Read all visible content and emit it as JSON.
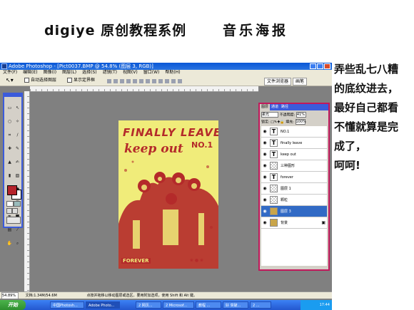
{
  "header": {
    "title": "digiye 原创教程系例",
    "subtitle": "音乐海报"
  },
  "window": {
    "title": "Adobe Photoshop - [Pict0037.BMP @ 54.8% (图层 3, RGB)]",
    "menu": [
      "文件(F)",
      "编辑(E)",
      "图像(I)",
      "图层(L)",
      "选择(S)",
      "滤镜(T)",
      "视图(V)",
      "窗口(W)",
      "帮助(H)"
    ],
    "options": {
      "auto_select": "自动选择图层",
      "show_bounds": "显示定界框",
      "tabs": [
        "文件浏览器",
        "画笔"
      ]
    },
    "statusbar": {
      "zoom": "54.89%",
      "doc": "文档:1.34M/54.6M",
      "hint": "点按并拖移以移动图层或选区。要用附加选项，使用 Shift 和 Alt 键。"
    }
  },
  "poster": {
    "line1": "FINALLY LEAVE",
    "line2": "NO.1",
    "line3": "keep out",
    "footer": "FOREVER"
  },
  "layers_panel": {
    "tabs": [
      "图层",
      "通道",
      "路径"
    ],
    "blend_mode": "柔光",
    "opacity_label": "不透明度:",
    "opacity": "41%",
    "lock_label": "锁定:",
    "fill_label": "填充:",
    "fill": "100%",
    "layers": [
      {
        "name": "NO.1",
        "type": "text"
      },
      {
        "name": "finally leave",
        "type": "text"
      },
      {
        "name": "keep out",
        "type": "text"
      },
      {
        "name": "三种图形",
        "type": "checker"
      },
      {
        "name": "forever",
        "type": "text"
      },
      {
        "name": "图层 1",
        "type": "checker"
      },
      {
        "name": "颗粒",
        "type": "checker"
      },
      {
        "name": "图层 3",
        "type": "img",
        "active": true
      },
      {
        "name": "背景",
        "type": "img",
        "locked": true
      }
    ]
  },
  "taskbar": {
    "start": "开始",
    "tasks": [
      "中国Photosh...",
      "Adobe Photo...",
      "2 网页...",
      "2 Microsof...",
      "教程 ...",
      "好 突破...",
      "2 ..."
    ],
    "clock": "17:44"
  },
  "side_text": [
    "弄些乱七八糟",
    "的底纹进去，",
    "最好自己都看",
    "不懂就算是完",
    "成了，",
    "呵呵!"
  ]
}
